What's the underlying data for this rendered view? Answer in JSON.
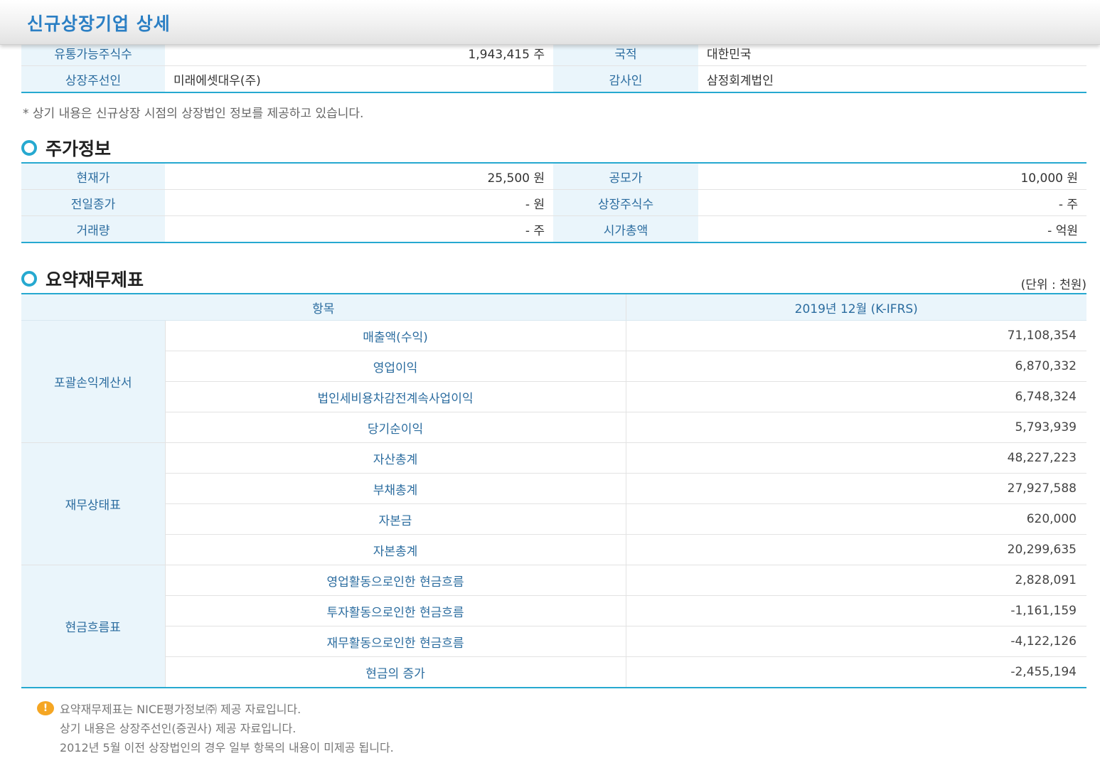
{
  "header": {
    "title": "신규상장기업 상세"
  },
  "company_info": {
    "rows": [
      [
        {
          "label": "유통가능주식수",
          "value": "1,943,415 주",
          "align": "r"
        },
        {
          "label": "국적",
          "value": "대한민국",
          "align": "l"
        }
      ],
      [
        {
          "label": "상장주선인",
          "value": "미래에셋대우(주)",
          "align": "l"
        },
        {
          "label": "감사인",
          "value": "삼정회계법인",
          "align": "l"
        }
      ]
    ],
    "note": "* 상기 내용은 신규상장 시점의 상장법인 정보를 제공하고 있습니다."
  },
  "price_section": {
    "title": "주가정보",
    "rows": [
      [
        {
          "label": "현재가",
          "value": "25,500 원"
        },
        {
          "label": "공모가",
          "value": "10,000 원"
        }
      ],
      [
        {
          "label": "전일종가",
          "value": "- 원"
        },
        {
          "label": "상장주식수",
          "value": "- 주"
        }
      ],
      [
        {
          "label": "거래량",
          "value": "- 주"
        },
        {
          "label": "시가총액",
          "value": "- 억원"
        }
      ]
    ]
  },
  "fin_section": {
    "title": "요약재무제표",
    "unit": "(단위 : 천원)",
    "col_item": "항목",
    "col_period": "2019년 12월 (K-IFRS)",
    "groups": [
      {
        "name": "포괄손익계산서",
        "items": [
          {
            "label": "매출액(수익)",
            "value": "71,108,354"
          },
          {
            "label": "영업이익",
            "value": "6,870,332"
          },
          {
            "label": "법인세비용차감전계속사업이익",
            "value": "6,748,324"
          },
          {
            "label": "당기순이익",
            "value": "5,793,939"
          }
        ]
      },
      {
        "name": "재무상태표",
        "items": [
          {
            "label": "자산총계",
            "value": "48,227,223"
          },
          {
            "label": "부채총계",
            "value": "27,927,588"
          },
          {
            "label": "자본금",
            "value": "620,000"
          },
          {
            "label": "자본총계",
            "value": "20,299,635"
          }
        ]
      },
      {
        "name": "현금흐름표",
        "items": [
          {
            "label": "영업활동으로인한 현금흐름",
            "value": "2,828,091"
          },
          {
            "label": "투자활동으로인한 현금흐름",
            "value": "-1,161,159"
          },
          {
            "label": "재무활동으로인한 현금흐름",
            "value": "-4,122,126"
          },
          {
            "label": "현금의 증가",
            "value": "-2,455,194"
          }
        ]
      }
    ]
  },
  "notes": {
    "icon": "warning-icon",
    "icon_glyph": "!",
    "lines": [
      "요약재무제표는 NICE평가정보㈜ 제공 자료입니다.",
      "상기 내용은 상장주선인(증권사) 제공 자료입니다.",
      "2012년 5월 이전 상장법인의 경우 일부 항목의 내용이 미제공 됩니다."
    ]
  },
  "colors": {
    "accent": "#26a9d0",
    "label_bg": "#eaf5fb",
    "label_text": "#2b6c9f",
    "title": "#2b7fc4"
  }
}
